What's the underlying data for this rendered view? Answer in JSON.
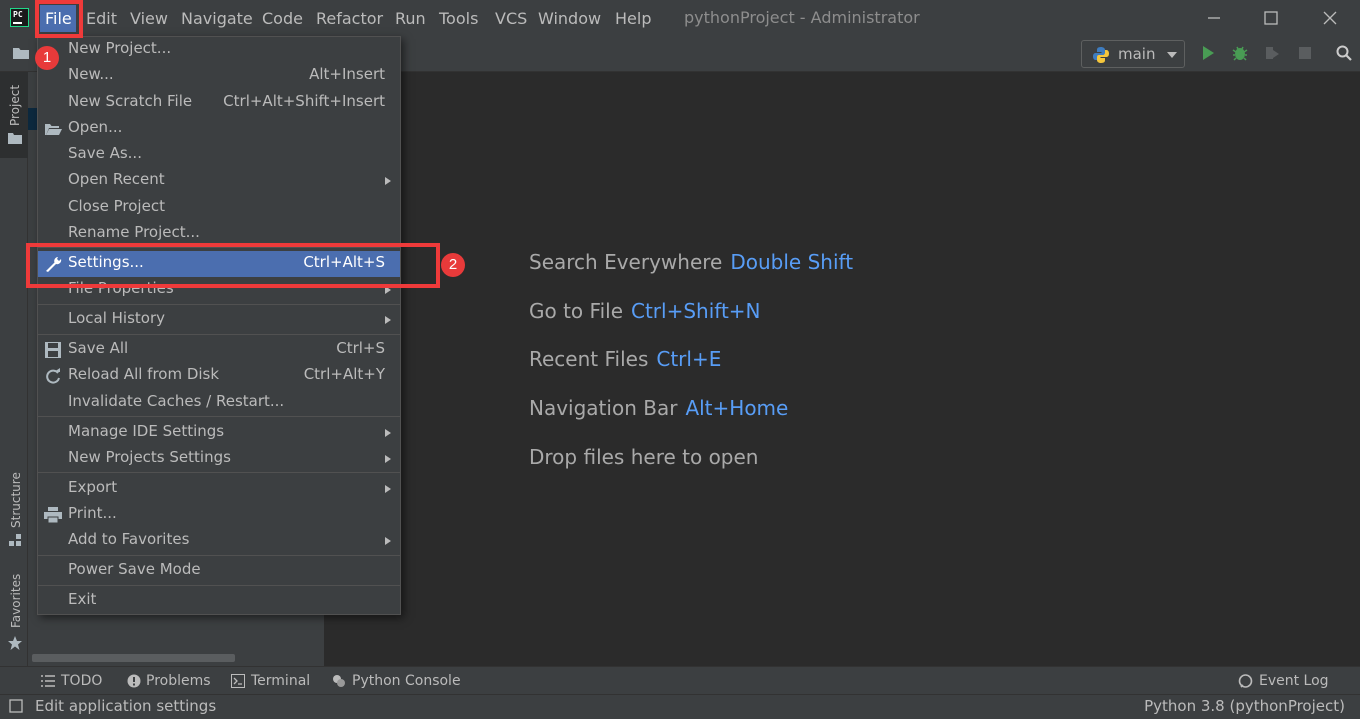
{
  "menubar": {
    "items": [
      "File",
      "Edit",
      "View",
      "Navigate",
      "Code",
      "Refactor",
      "Run",
      "Tools",
      "VCS",
      "Window",
      "Help"
    ],
    "window_title": "pythonProject - Administrator"
  },
  "toolbar": {
    "run_config": "main"
  },
  "left_strip": {
    "project": "Project",
    "structure": "Structure",
    "favorites": "Favorites"
  },
  "file_menu": {
    "items": [
      {
        "label": "New Project...",
        "shortcut": ""
      },
      {
        "label": "New...",
        "shortcut": "Alt+Insert"
      },
      {
        "label": "New Scratch File",
        "shortcut": "Ctrl+Alt+Shift+Insert"
      },
      {
        "label": "Open...",
        "shortcut": "",
        "icon": "folder-open-icon"
      },
      {
        "label": "Save As...",
        "shortcut": ""
      },
      {
        "label": "Open Recent",
        "shortcut": "",
        "submenu": true
      },
      {
        "label": "Close Project",
        "shortcut": ""
      },
      {
        "label": "Rename Project...",
        "shortcut": ""
      },
      {
        "label": "Settings...",
        "shortcut": "Ctrl+Alt+S",
        "icon": "wrench-icon",
        "selected": true
      },
      {
        "label": "File Properties",
        "shortcut": "",
        "submenu": true
      },
      {
        "label": "Local History",
        "shortcut": "",
        "submenu": true
      },
      {
        "label": "Save All",
        "shortcut": "Ctrl+S",
        "icon": "save-icon"
      },
      {
        "label": "Reload All from Disk",
        "shortcut": "Ctrl+Alt+Y",
        "icon": "reload-icon"
      },
      {
        "label": "Invalidate Caches / Restart...",
        "shortcut": ""
      },
      {
        "label": "Manage IDE Settings",
        "shortcut": "",
        "submenu": true
      },
      {
        "label": "New Projects Settings",
        "shortcut": "",
        "submenu": true
      },
      {
        "label": "Export",
        "shortcut": "",
        "submenu": true
      },
      {
        "label": "Print...",
        "shortcut": "",
        "icon": "print-icon"
      },
      {
        "label": "Add to Favorites",
        "shortcut": "",
        "submenu": true
      },
      {
        "label": "Power Save Mode",
        "shortcut": ""
      },
      {
        "label": "Exit",
        "shortcut": ""
      }
    ]
  },
  "annotations": {
    "step1": "1",
    "step2": "2"
  },
  "welcome": {
    "hints": [
      {
        "text": "Search Everywhere",
        "key": "Double Shift"
      },
      {
        "text": "Go to File",
        "key": "Ctrl+Shift+N"
      },
      {
        "text": "Recent Files",
        "key": "Ctrl+E"
      },
      {
        "text": "Navigation Bar",
        "key": "Alt+Home"
      },
      {
        "text": "Drop files here to open",
        "key": ""
      }
    ]
  },
  "bottom_tools": {
    "todo": "TODO",
    "problems": "Problems",
    "terminal": "Terminal",
    "python_console": "Python Console",
    "event_log": "Event Log"
  },
  "status": {
    "text": "Edit application settings",
    "interpreter": "Python 3.8 (pythonProject)"
  },
  "colors": {
    "accent": "#4b6eaf",
    "shortcut_key": "#589df6",
    "annotation": "#ef3a3a"
  }
}
